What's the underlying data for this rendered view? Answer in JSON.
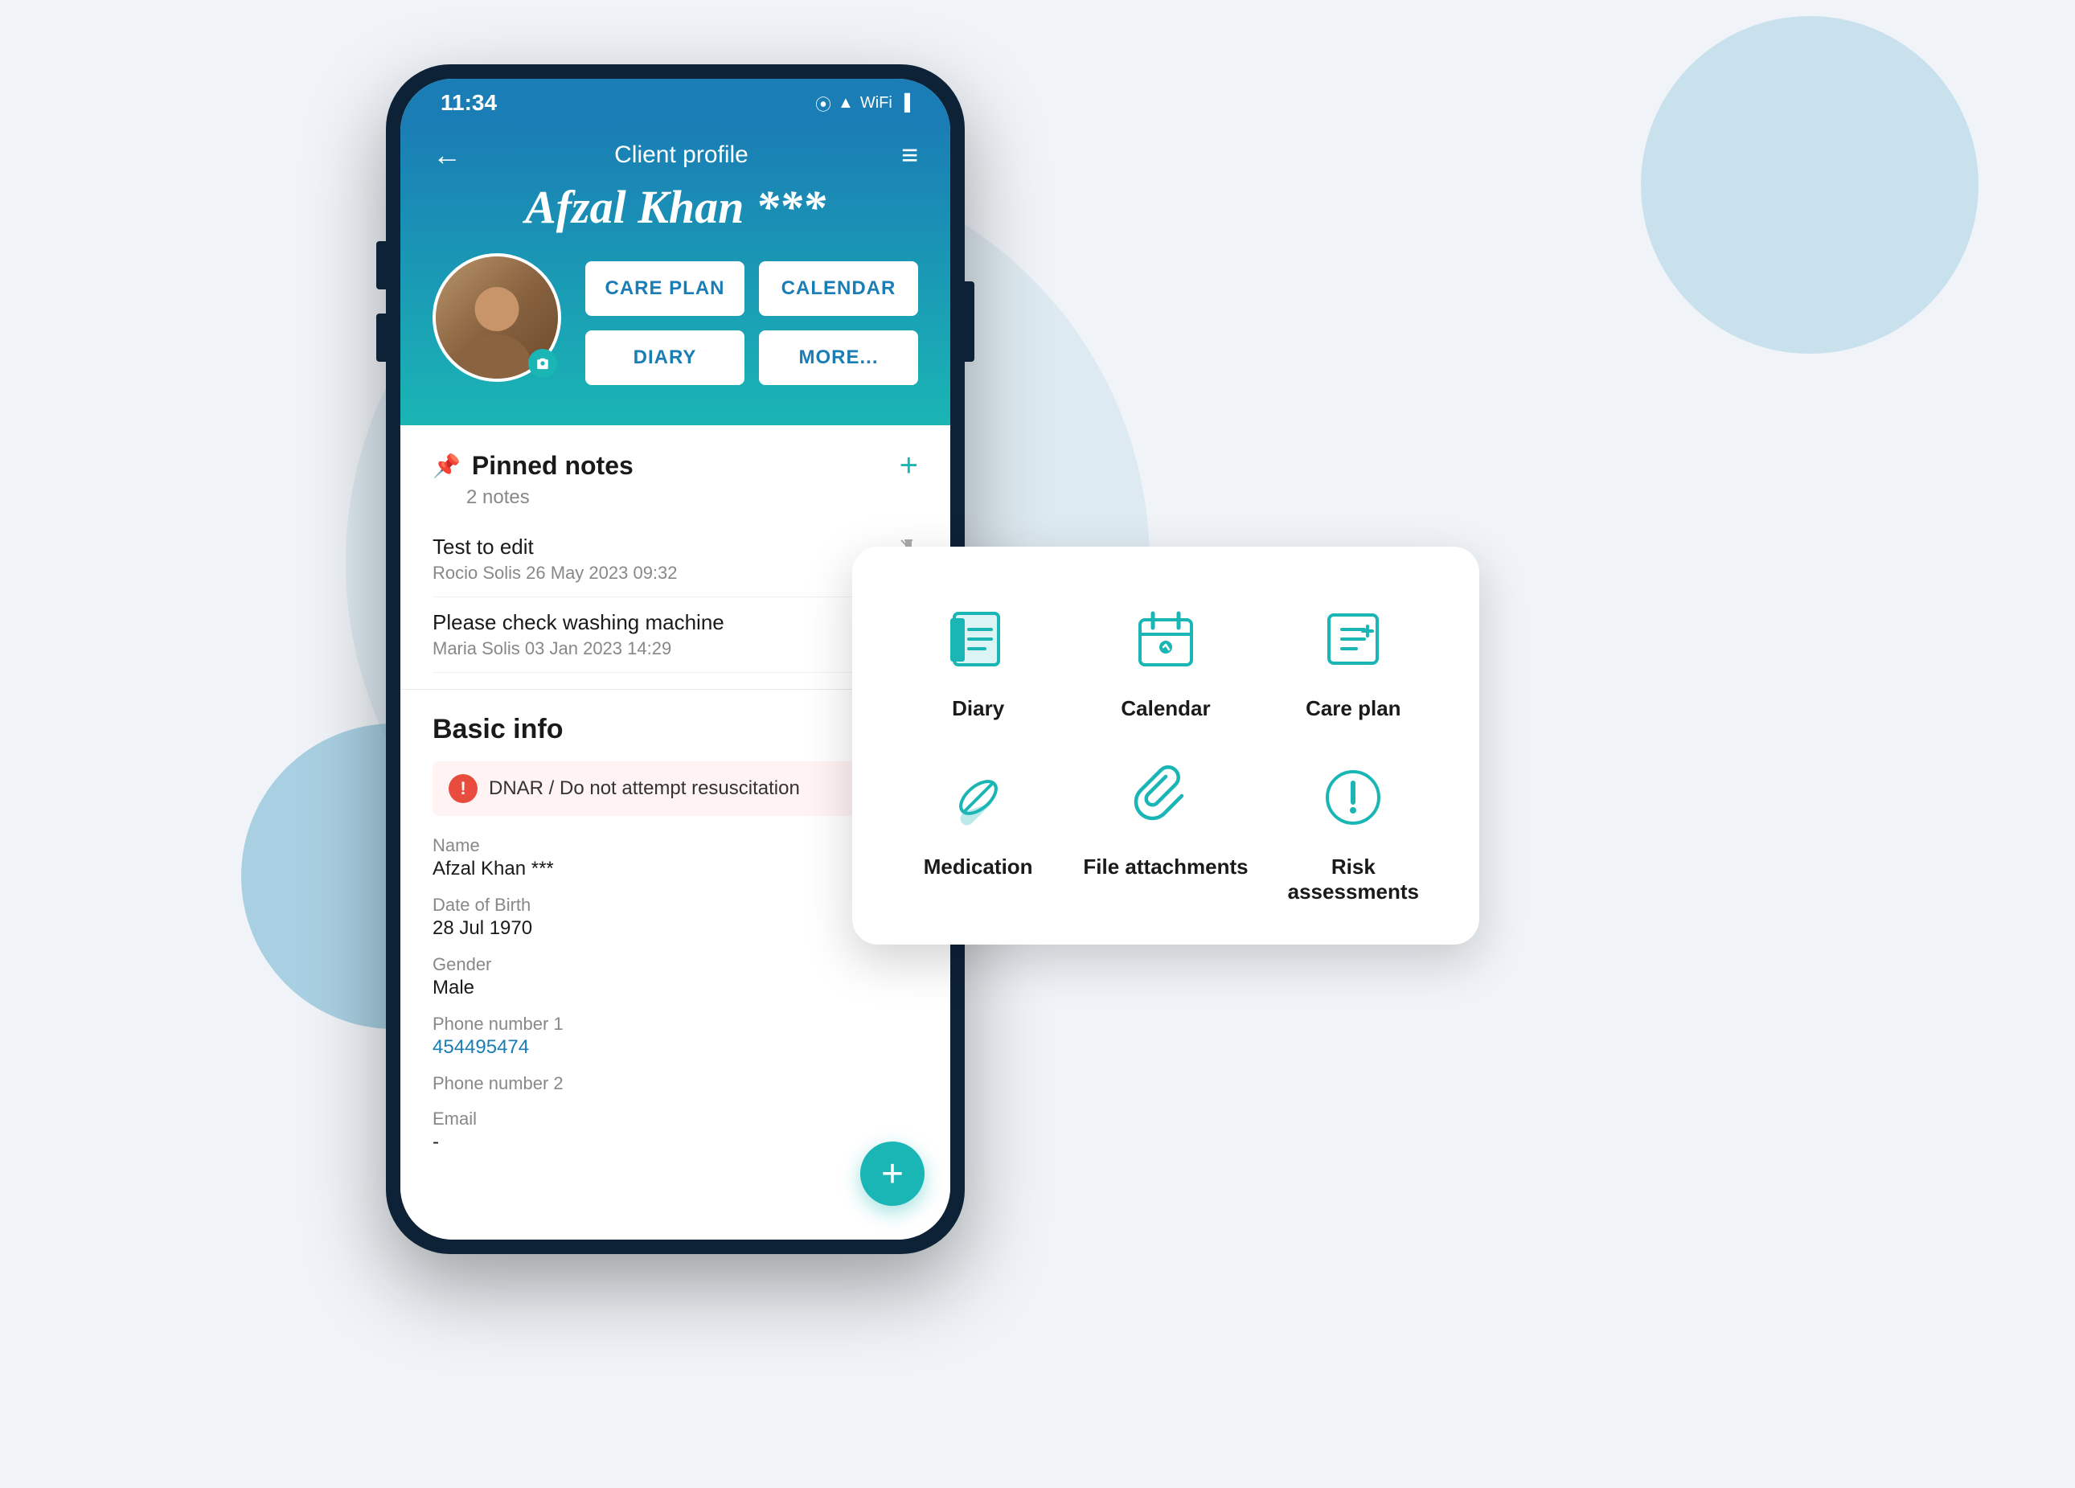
{
  "background": {
    "color": "#f0f4f8"
  },
  "phone": {
    "status_bar": {
      "time": "11:34",
      "icons": [
        "📍",
        "▲",
        "WiFi",
        "Battery"
      ]
    },
    "header": {
      "title": "Client profile",
      "client_name": "Afzal Khan ***",
      "back_icon": "←",
      "menu_icon": "≡"
    },
    "action_buttons": [
      {
        "label": "CARE PLAN"
      },
      {
        "label": "CALENDAR"
      },
      {
        "label": "DIARY"
      },
      {
        "label": "MORE..."
      }
    ],
    "pinned_notes": {
      "title": "Pinned notes",
      "subtitle": "2 notes",
      "add_icon": "+",
      "notes": [
        {
          "title": "Test to edit",
          "meta": "Rocio Solis 26 May 2023 09:32"
        },
        {
          "title": "Please check washing machine",
          "meta": "Maria Solis 03 Jan 2023 14:29"
        }
      ]
    },
    "basic_info": {
      "title": "Basic info",
      "dnar": "DNAR / Do not attempt resuscitation",
      "fields": [
        {
          "label": "Name",
          "value": "Afzal Khan ***",
          "link": false
        },
        {
          "label": "Date of Birth",
          "value": "28 Jul 1970",
          "link": false
        },
        {
          "label": "Gender",
          "value": "Male",
          "link": false
        },
        {
          "label": "Phone number 1",
          "value": "454495474",
          "link": true
        },
        {
          "label": "Phone number 2",
          "value": "",
          "link": false
        },
        {
          "label": "Email",
          "value": "-",
          "link": false
        }
      ]
    },
    "fab_label": "+"
  },
  "tablet_card": {
    "items": [
      {
        "name": "Diary",
        "icon": "diary"
      },
      {
        "name": "Calendar",
        "icon": "calendar"
      },
      {
        "name": "Care plan",
        "icon": "careplan"
      },
      {
        "name": "Medication",
        "icon": "medication"
      },
      {
        "name": "File attachments",
        "icon": "attachment"
      },
      {
        "name": "Risk assessments",
        "icon": "risk"
      }
    ]
  }
}
